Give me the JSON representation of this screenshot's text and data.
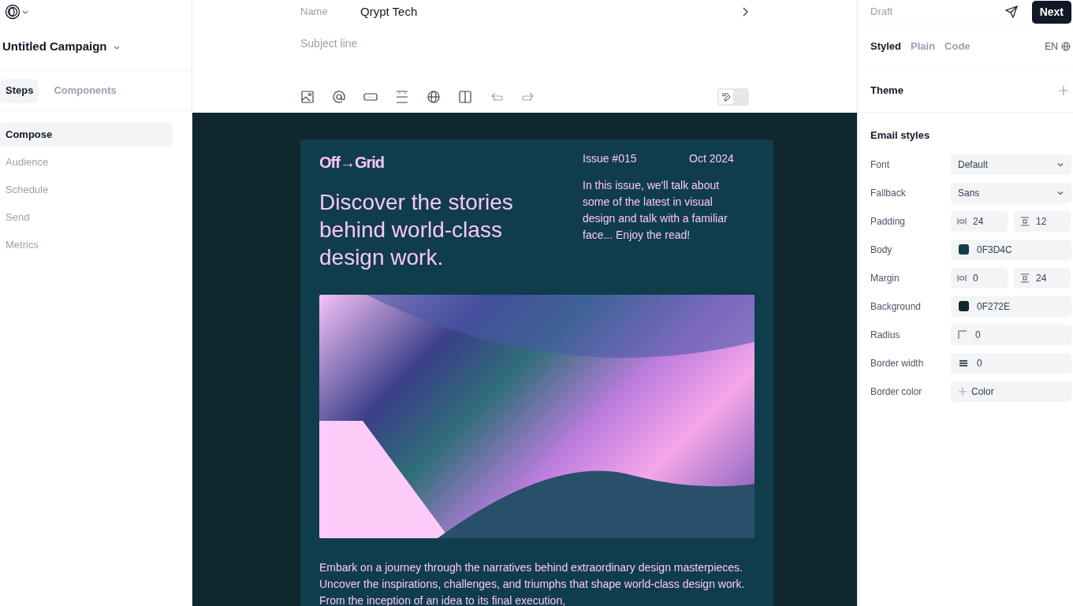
{
  "sidebar": {
    "campaign": "Untitled Campaign",
    "tabs": [
      {
        "label": "Steps",
        "selected": true
      },
      {
        "label": "Components",
        "selected": false
      }
    ],
    "steps": [
      {
        "label": "Compose",
        "selected": true
      },
      {
        "label": "Audience",
        "selected": false
      },
      {
        "label": "Schedule",
        "selected": false
      },
      {
        "label": "Send",
        "selected": false
      },
      {
        "label": "Metrics",
        "selected": false
      }
    ]
  },
  "header": {
    "name_label": "Name",
    "name_value": "Qrypt Tech",
    "subject_placeholder": "Subject line",
    "toolbar": [
      {
        "kind": "image",
        "disabled": false
      },
      {
        "kind": "mention",
        "disabled": false
      },
      {
        "kind": "button",
        "disabled": false
      },
      {
        "kind": "spacer",
        "disabled": false
      },
      {
        "kind": "globe",
        "disabled": false
      },
      {
        "kind": "columns",
        "disabled": false
      },
      {
        "kind": "undo",
        "disabled": true
      },
      {
        "kind": "redo",
        "disabled": true
      }
    ],
    "edit_toggle": {
      "on": false
    }
  },
  "email": {
    "logo": "Off→Grid",
    "issue": "Issue #015",
    "date": "Oct 2024",
    "headline": "Discover the stories behind world-class design work.",
    "intro": "In this issue, we'll talk about some of the latest in visual design and talk with a familiar face... Enjoy the read!",
    "body": "Embark on a journey through the narratives behind extraordinary design masterpieces. Uncover the inspirations, challenges, and triumphs that shape world-class design work. From the inception of an idea to its final execution,"
  },
  "right_panel": {
    "status": "Draft",
    "next_button": "Next",
    "view_tabs": [
      {
        "label": "Styled",
        "selected": true
      },
      {
        "label": "Plain",
        "selected": false
      },
      {
        "label": "Code",
        "selected": false
      }
    ],
    "language": "EN",
    "theme_title": "Theme",
    "styles_title": "Email styles",
    "styles": [
      {
        "label": "Font",
        "kind": "select",
        "value": "Default"
      },
      {
        "label": "Fallback",
        "kind": "select",
        "value": "Sans"
      },
      {
        "label": "Padding",
        "kind": "pair",
        "values": [
          "24",
          "12"
        ]
      },
      {
        "label": "Body",
        "kind": "color",
        "value": "0F3D4C",
        "color": "#0f3d4c"
      },
      {
        "label": "Margin",
        "kind": "pair",
        "values": [
          "0",
          "24"
        ]
      },
      {
        "label": "Background",
        "kind": "color",
        "value": "0F272E",
        "color": "#0f272e"
      },
      {
        "label": "Radius",
        "kind": "radius",
        "value": "0"
      },
      {
        "label": "Border width",
        "kind": "border",
        "value": "0"
      },
      {
        "label": "Border color",
        "kind": "add",
        "value": "Color"
      }
    ]
  }
}
